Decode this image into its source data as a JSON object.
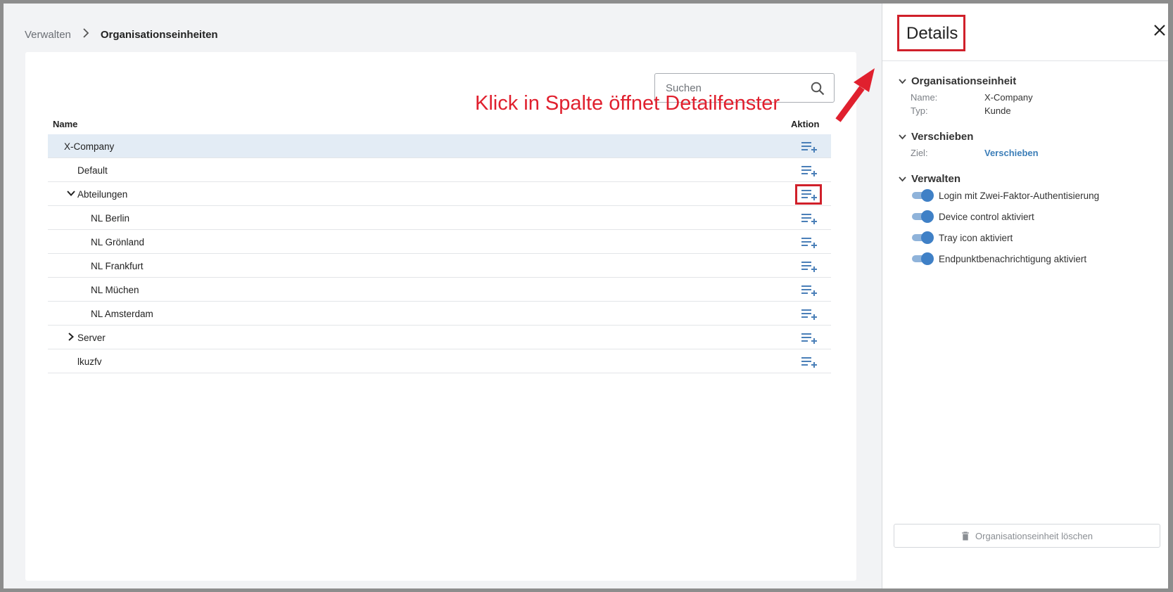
{
  "breadcrumb": {
    "parent": "Verwalten",
    "current": "Organisationseinheiten"
  },
  "search": {
    "placeholder": "Suchen"
  },
  "table": {
    "col_name": "Name",
    "col_action": "Aktion",
    "rows": [
      {
        "label": "X-Company",
        "level": 0,
        "selected": true
      },
      {
        "label": "Default",
        "level": 1
      },
      {
        "label": "Abteilungen",
        "level": 1,
        "expanded": true
      },
      {
        "label": "NL Berlin",
        "level": 2
      },
      {
        "label": "NL Grönland",
        "level": 2
      },
      {
        "label": "NL Frankfurt",
        "level": 2
      },
      {
        "label": "NL Müchen",
        "level": 2
      },
      {
        "label": "NL Amsterdam",
        "level": 2
      },
      {
        "label": "Server",
        "level": 1,
        "expanded": false
      },
      {
        "label": "lkuzfv",
        "level": 1
      }
    ]
  },
  "annotation": {
    "text": "Klick in Spalte öffnet Detailfenster",
    "color": "#e0202e"
  },
  "details": {
    "title": "Details",
    "sections": {
      "unit": {
        "heading": "Organisationseinheit",
        "name_key": "Name:",
        "name_value": "X-Company",
        "type_key": "Typ:",
        "type_value": "Kunde"
      },
      "move": {
        "heading": "Verschieben",
        "target_key": "Ziel:",
        "target_link": "Verschieben"
      },
      "manage": {
        "heading": "Verwalten",
        "toggles": [
          {
            "label": "Login mit Zwei-Faktor-Authentisierung",
            "on": true
          },
          {
            "label": "Device control aktiviert",
            "on": true
          },
          {
            "label": "Tray icon aktiviert",
            "on": true
          },
          {
            "label": "Endpunktbenachrichtigung aktiviert",
            "on": true
          }
        ]
      }
    },
    "delete_label": "Organisationseinheit löschen"
  },
  "colors": {
    "accent": "#3f80c6",
    "highlight": "#d0202a",
    "selected_row": "#e3ecf5"
  },
  "icons": [
    "chevron-right-icon",
    "search-icon",
    "playlist-add-icon",
    "chevron-down-icon",
    "close-icon",
    "trash-icon"
  ]
}
